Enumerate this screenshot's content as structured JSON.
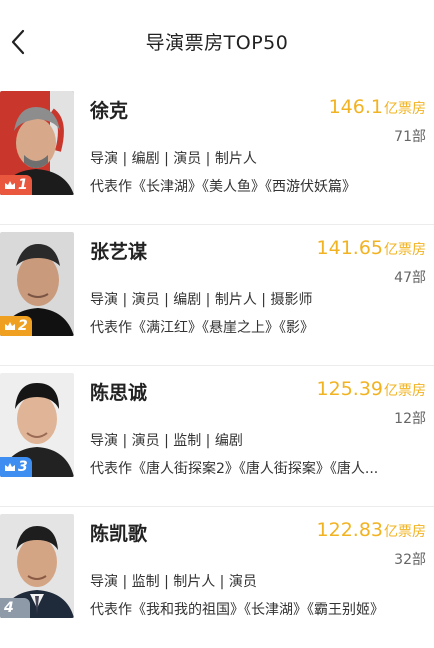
{
  "header": {
    "title": "导演票房TOP50",
    "back_icon": "chevron-left-icon"
  },
  "unit": "亿票房",
  "directors": [
    {
      "rank": "1",
      "badge_color": "#e9573f",
      "badge_icon": "crown-icon",
      "name": "徐克",
      "box_office": "146.1",
      "count": "71部",
      "roles": "导演 | 编剧 | 演员 | 制片人",
      "works": "代表作《长津湖》《美人鱼》《西游伏妖篇》"
    },
    {
      "rank": "2",
      "badge_color": "#f0a020",
      "badge_icon": "crown-icon",
      "name": "张艺谋",
      "box_office": "141.65",
      "count": "47部",
      "roles": "导演 | 演员 | 编剧 | 制片人 | 摄影师",
      "works": "代表作《满江红》《悬崖之上》《影》"
    },
    {
      "rank": "3",
      "badge_color": "#3d8ef0",
      "badge_icon": "crown-icon",
      "name": "陈思诚",
      "box_office": "125.39",
      "count": "12部",
      "roles": "导演 | 演员 | 监制 | 编剧",
      "works": "代表作《唐人街探案2》《唐人街探案》《唐人..."
    },
    {
      "rank": "4",
      "badge_color": "#8f9aa8",
      "badge_icon": "",
      "name": "陈凯歌",
      "box_office": "122.83",
      "count": "32部",
      "roles": "导演 | 监制 | 制片人 | 演员",
      "works": "代表作《我和我的祖国》《长津湖》《霸王别姬》"
    }
  ]
}
